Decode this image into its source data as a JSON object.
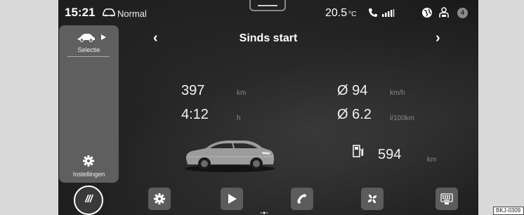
{
  "status_bar": {
    "time": "15:21",
    "drive_mode": "Normal",
    "temperature": "20.5",
    "temperature_unit": "°C",
    "notification_count": "4"
  },
  "sidebar": {
    "selectie_label": "Selectie",
    "instellingen_label": "Instellingen"
  },
  "trip": {
    "title": "Sinds start",
    "distance": "397",
    "distance_unit": "km",
    "duration": "4:12",
    "duration_unit": "h",
    "avg_speed": "Ø 94",
    "avg_speed_unit": "km/h",
    "avg_consumption": "Ø 6.2",
    "avg_consumption_unit": "l/100km",
    "range": "594",
    "range_unit": "km"
  },
  "dock": {
    "menu_label": "///"
  },
  "image_code": "BKJ-0309",
  "icons": [
    "car-icon",
    "play-icon",
    "gear-icon",
    "chevron-left-icon",
    "chevron-right-icon",
    "phone-icon",
    "signal-icon",
    "globe-icon",
    "person-icon",
    "fuel-pump-icon",
    "fan-icon",
    "keyboard-icon"
  ],
  "colors": {
    "screen_bg": "#222222",
    "panel": "#5f5f5f",
    "dock_button": "#5c5c5c",
    "unit_text": "#8a8a8a"
  }
}
